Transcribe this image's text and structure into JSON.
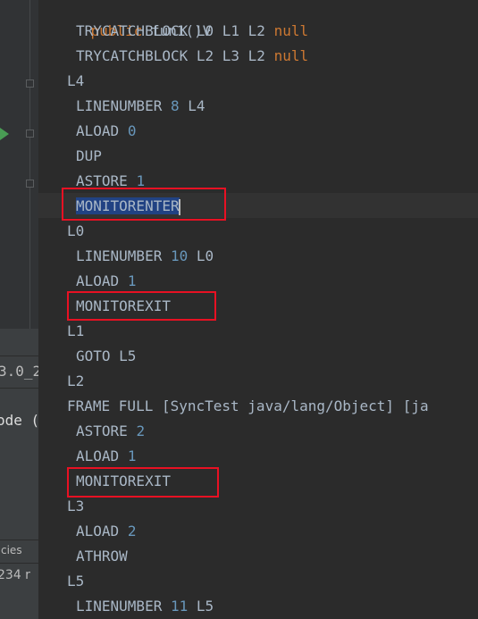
{
  "left_panel": {
    "version_fragment": "3.0_2",
    "mode_fragment": "ode (",
    "tab_fragment": "cies",
    "count_fragment": "234 r",
    "run_icon": "play-icon",
    "fold_icon": "fold-marker-icon"
  },
  "editor": {
    "header_keyword": "public",
    "header_text": " fun1()V",
    "lines": [
      {
        "indent": "  ",
        "op": "TRYCATCHBLOCK",
        "args": "L0 L1 L2",
        "kw": "null"
      },
      {
        "indent": "  ",
        "op": "TRYCATCHBLOCK",
        "args": "L2 L3 L2",
        "kw": "null"
      },
      {
        "indent": " ",
        "op": "L4"
      },
      {
        "indent": "  ",
        "op": "LINENUMBER",
        "num": "8",
        "args": "L4"
      },
      {
        "indent": "  ",
        "op": "ALOAD",
        "num": "0"
      },
      {
        "indent": "  ",
        "op": "DUP"
      },
      {
        "indent": "  ",
        "op": "ASTORE",
        "num": "1"
      },
      {
        "indent": "  ",
        "op": "MONITORENTER",
        "selected": true
      },
      {
        "indent": " ",
        "op": "L0"
      },
      {
        "indent": "  ",
        "op": "LINENUMBER",
        "num": "10",
        "args": "L0"
      },
      {
        "indent": "  ",
        "op": "ALOAD",
        "num": "1"
      },
      {
        "indent": "  ",
        "op": "MONITOREXIT"
      },
      {
        "indent": " ",
        "op": "L1"
      },
      {
        "indent": "  ",
        "op": "GOTO",
        "args": "L5"
      },
      {
        "indent": " ",
        "op": "L2"
      },
      {
        "indent": " ",
        "op": "FRAME FULL",
        "args": "[SyncTest java/lang/Object] [ja"
      },
      {
        "indent": "  ",
        "op": "ASTORE",
        "num": "2"
      },
      {
        "indent": "  ",
        "op": "ALOAD",
        "num": "1"
      },
      {
        "indent": "  ",
        "op": "MONITOREXIT"
      },
      {
        "indent": " ",
        "op": "L3"
      },
      {
        "indent": "  ",
        "op": "ALOAD",
        "num": "2"
      },
      {
        "indent": "  ",
        "op": "ATHROW"
      },
      {
        "indent": " ",
        "op": "L5"
      },
      {
        "indent": "  ",
        "op": "LINENUMBER",
        "num": "11",
        "args": "L5"
      }
    ]
  },
  "colors": {
    "background": "#2b2b2b",
    "text": "#a9b7c6",
    "keyword": "#cc7832",
    "number": "#6897bb",
    "selection": "#214283",
    "highlight_box": "#e81123"
  }
}
